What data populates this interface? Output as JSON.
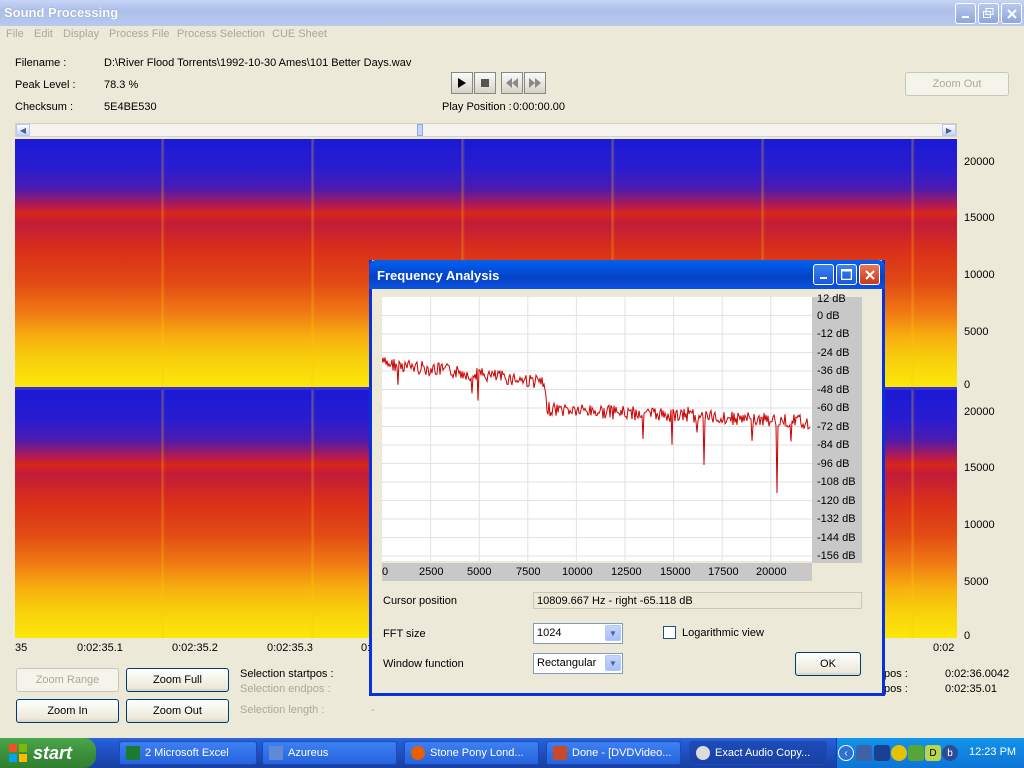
{
  "window": {
    "title": "Sound Processing"
  },
  "menu": [
    "File",
    "Edit",
    "Display",
    "Process File",
    "Process Selection",
    "CUE Sheet"
  ],
  "info": {
    "filename_label": "Filename :",
    "filename": "D:\\River Flood Torrents\\1992-10-30 Ames\\101 Better Days.wav",
    "peak_label": "Peak Level :",
    "peak": "78.3 %",
    "checksum_label": "Checksum :",
    "checksum": "5E4BE530",
    "play_position_label": "Play Position :",
    "play_position": "0:00:00.00"
  },
  "zoom_out_top": "Zoom Out",
  "spectrogram": {
    "y_ticks_top": [
      "20000",
      "15000",
      "10000",
      "5000",
      "0"
    ],
    "y_ticks_bottom": [
      "20000",
      "15000",
      "10000",
      "5000",
      "0"
    ],
    "time_labels": [
      "35",
      "0:02:35.1",
      "0:02:35.2",
      "0:02:35.3",
      "0:",
      "0:02"
    ]
  },
  "bottom": {
    "zoom_range": "Zoom Range",
    "zoom_full": "Zoom Full",
    "zoom_in": "Zoom In",
    "zoom_out": "Zoom Out",
    "sel_start_label": "Selection startpos :",
    "sel_end_label": "Selection endpos :",
    "sel_length_label": "Selection length :",
    "sel_length_value": "-",
    "pos_label_1": "pos :",
    "pos_value_1": "0:02:36.0042",
    "pos_label_2": "pos :",
    "pos_value_2": "0:02:35.01"
  },
  "dialog": {
    "title": "Frequency Analysis",
    "db_ticks": [
      "12 dB",
      "0 dB",
      "-12 dB",
      "-24 dB",
      "-36 dB",
      "-48 dB",
      "-60 dB",
      "-72 dB",
      "-84 dB",
      "-96 dB",
      "-108 dB",
      "-120 dB",
      "-132 dB",
      "-144 dB",
      "-156 dB"
    ],
    "freq_ticks": [
      "0",
      "2500",
      "5000",
      "7500",
      "10000",
      "12500",
      "15000",
      "17500",
      "20000"
    ],
    "cursor_label": "Cursor position",
    "cursor_value": "10809.667 Hz  -  right -65.118 dB",
    "fft_label": "FFT size",
    "fft_value": "1024",
    "log_label": "Logarithmic view",
    "window_label": "Window function",
    "window_value": "Rectangular",
    "ok": "OK",
    "line_color": "#cc0000"
  },
  "taskbar": {
    "start": "start",
    "tasks": [
      "2 Microsoft Excel",
      "Azureus",
      "Stone Pony Lond...",
      "Done - [DVDVideo...",
      "Exact Audio Copy..."
    ],
    "clock": "12:23 PM"
  }
}
